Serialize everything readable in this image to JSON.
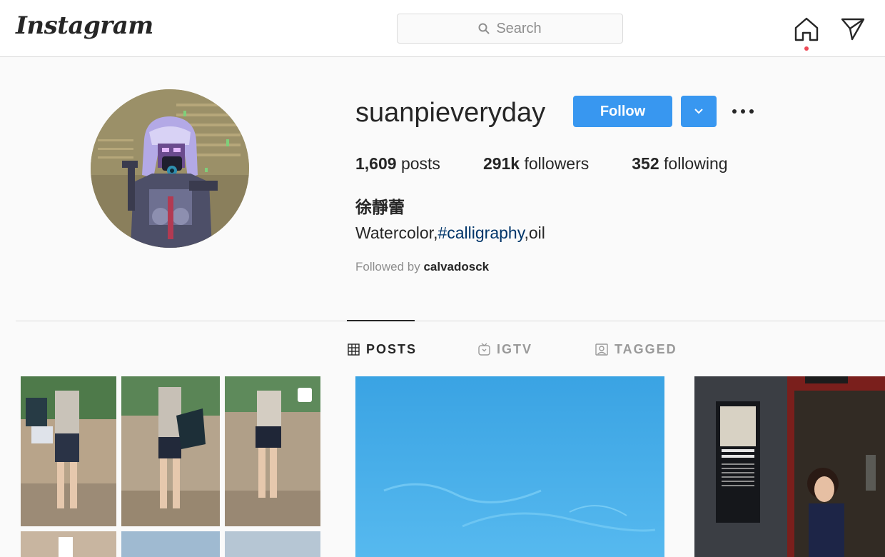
{
  "header": {
    "logo": "Instagram",
    "search_placeholder": "Search",
    "home_icon": "home-icon",
    "direct_icon": "paper-plane-icon"
  },
  "profile": {
    "username": "suanpieveryday",
    "follow_label": "Follow",
    "stats": {
      "posts_count": "1,609",
      "posts_label": " posts",
      "followers_count": "291k",
      "followers_label": " followers",
      "following_count": "352",
      "following_label": " following"
    },
    "full_name": "徐靜蕾",
    "bio": {
      "part1": "Watercolor,",
      "hashtag": "#calligraphy",
      "part2": ",oil"
    },
    "followed_by_label": "Followed by ",
    "followed_by_user": "calvadosck"
  },
  "tabs": [
    {
      "label": "POSTS",
      "icon": "grid-icon",
      "active": true
    },
    {
      "label": "IGTV",
      "icon": "igtv-icon",
      "active": false
    },
    {
      "label": "TAGGED",
      "icon": "tagged-icon",
      "active": false
    }
  ],
  "colors": {
    "accent": "#3897f0",
    "hashtag": "#003569",
    "notification": "#ed4956"
  }
}
